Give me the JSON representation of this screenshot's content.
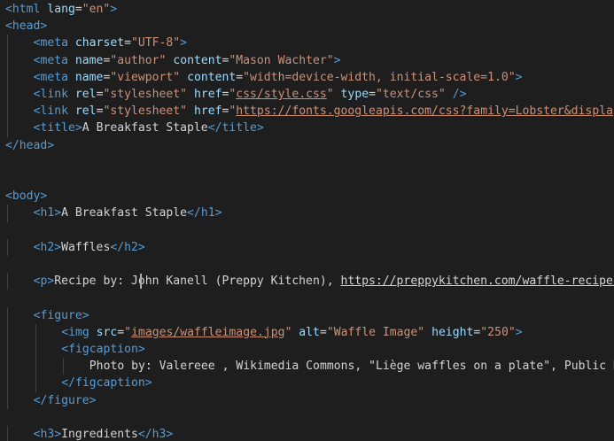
{
  "editor": {
    "language": "html",
    "colors": {
      "background": "#1e1e1e",
      "tag": "#569cd6",
      "attribute": "#9cdcfe",
      "string": "#ce9178",
      "text": "#d4d4d4"
    },
    "lines": [
      {
        "indent": 0,
        "tokens": [
          [
            "tag",
            "<html"
          ],
          [
            "txt",
            " "
          ],
          [
            "attr",
            "lang"
          ],
          [
            "txt",
            "="
          ],
          [
            "str",
            "\"en\""
          ],
          [
            "tag",
            ">"
          ]
        ]
      },
      {
        "indent": 0,
        "tokens": [
          [
            "tag",
            "<head"
          ],
          [
            "tag",
            ">"
          ]
        ]
      },
      {
        "indent": 1,
        "tokens": [
          [
            "tag",
            "<meta"
          ],
          [
            "txt",
            " "
          ],
          [
            "attr",
            "charset"
          ],
          [
            "txt",
            "="
          ],
          [
            "str",
            "\"UTF-8\""
          ],
          [
            "tag",
            ">"
          ]
        ]
      },
      {
        "indent": 1,
        "tokens": [
          [
            "tag",
            "<meta"
          ],
          [
            "txt",
            " "
          ],
          [
            "attr",
            "name"
          ],
          [
            "txt",
            "="
          ],
          [
            "str",
            "\"author\""
          ],
          [
            "txt",
            " "
          ],
          [
            "attr",
            "content"
          ],
          [
            "txt",
            "="
          ],
          [
            "str",
            "\"Mason Wachter\""
          ],
          [
            "tag",
            ">"
          ]
        ]
      },
      {
        "indent": 1,
        "tokens": [
          [
            "tag",
            "<meta"
          ],
          [
            "txt",
            " "
          ],
          [
            "attr",
            "name"
          ],
          [
            "txt",
            "="
          ],
          [
            "str",
            "\"viewport\""
          ],
          [
            "txt",
            " "
          ],
          [
            "attr",
            "content"
          ],
          [
            "txt",
            "="
          ],
          [
            "str",
            "\"width=device-width, initial-scale=1.0\""
          ],
          [
            "tag",
            ">"
          ]
        ]
      },
      {
        "indent": 1,
        "tokens": [
          [
            "tag",
            "<link"
          ],
          [
            "txt",
            " "
          ],
          [
            "attr",
            "rel"
          ],
          [
            "txt",
            "="
          ],
          [
            "str",
            "\"stylesheet\""
          ],
          [
            "txt",
            " "
          ],
          [
            "attr",
            "href"
          ],
          [
            "txt",
            "="
          ],
          [
            "str",
            "\""
          ],
          [
            "str-link",
            "css/style.css"
          ],
          [
            "str",
            "\""
          ],
          [
            "txt",
            " "
          ],
          [
            "attr",
            "type"
          ],
          [
            "txt",
            "="
          ],
          [
            "str",
            "\"text/css\""
          ],
          [
            "txt",
            " "
          ],
          [
            "tag",
            "/>"
          ]
        ]
      },
      {
        "indent": 1,
        "tokens": [
          [
            "tag",
            "<link"
          ],
          [
            "txt",
            " "
          ],
          [
            "attr",
            "rel"
          ],
          [
            "txt",
            "="
          ],
          [
            "str",
            "\"stylesheet\""
          ],
          [
            "txt",
            " "
          ],
          [
            "attr",
            "href"
          ],
          [
            "txt",
            "="
          ],
          [
            "str",
            "\""
          ],
          [
            "str-link",
            "https://fonts.googleapis.com/css?family=Lobster&display=swap"
          ],
          [
            "str",
            "\""
          ],
          [
            "txt",
            " "
          ],
          [
            "tag",
            "/>"
          ]
        ]
      },
      {
        "indent": 1,
        "tokens": [
          [
            "tag",
            "<title"
          ],
          [
            "tag",
            ">"
          ],
          [
            "txt",
            "A Breakfast Staple"
          ],
          [
            "tag",
            "</title>"
          ]
        ]
      },
      {
        "indent": 0,
        "tokens": [
          [
            "tag",
            "</head>"
          ]
        ]
      },
      {
        "indent": 0,
        "tokens": []
      },
      {
        "indent": 0,
        "tokens": []
      },
      {
        "indent": 0,
        "tokens": [
          [
            "tag",
            "<body"
          ],
          [
            "tag",
            ">"
          ]
        ]
      },
      {
        "indent": 1,
        "tokens": [
          [
            "tag",
            "<h1"
          ],
          [
            "tag",
            ">"
          ],
          [
            "txt",
            "A Breakfast Staple"
          ],
          [
            "tag",
            "</h1>"
          ]
        ]
      },
      {
        "indent": 0,
        "tokens": []
      },
      {
        "indent": 1,
        "tokens": [
          [
            "tag",
            "<h2"
          ],
          [
            "tag",
            ">"
          ],
          [
            "txt",
            "Waffles"
          ],
          [
            "tag",
            "</h2>"
          ]
        ]
      },
      {
        "indent": 0,
        "tokens": []
      },
      {
        "indent": 1,
        "tokens": [
          [
            "tag",
            "<p"
          ],
          [
            "tag",
            ">"
          ],
          [
            "txt",
            "Recipe by: John Kanell (Preppy Kitchen), "
          ],
          [
            "txt-link",
            "https://preppykitchen.com/waffle-recipe/"
          ],
          [
            "tag",
            "</p>"
          ]
        ]
      },
      {
        "indent": 0,
        "tokens": []
      },
      {
        "indent": 1,
        "tokens": [
          [
            "tag",
            "<figure"
          ],
          [
            "tag",
            ">"
          ]
        ]
      },
      {
        "indent": 2,
        "tokens": [
          [
            "tag",
            "<img"
          ],
          [
            "txt",
            " "
          ],
          [
            "attr",
            "src"
          ],
          [
            "txt",
            "="
          ],
          [
            "str",
            "\""
          ],
          [
            "str-link",
            "images/waffleimage.jpg"
          ],
          [
            "str",
            "\""
          ],
          [
            "txt",
            " "
          ],
          [
            "attr",
            "alt"
          ],
          [
            "txt",
            "="
          ],
          [
            "str",
            "\"Waffle Image\""
          ],
          [
            "txt",
            " "
          ],
          [
            "attr",
            "height"
          ],
          [
            "txt",
            "="
          ],
          [
            "str",
            "\"250\""
          ],
          [
            "tag",
            ">"
          ]
        ]
      },
      {
        "indent": 2,
        "tokens": [
          [
            "tag",
            "<figcaption"
          ],
          [
            "tag",
            ">"
          ]
        ]
      },
      {
        "indent": 3,
        "tokens": [
          [
            "txt",
            "Photo by: Valereee , Wikimedia Commons, \"Liège waffles on a plate\", Public Domain"
          ]
        ]
      },
      {
        "indent": 2,
        "tokens": [
          [
            "tag",
            "</figcaption>"
          ]
        ]
      },
      {
        "indent": 1,
        "tokens": [
          [
            "tag",
            "</figure>"
          ]
        ]
      },
      {
        "indent": 0,
        "tokens": []
      },
      {
        "indent": 1,
        "tokens": [
          [
            "tag",
            "<h3"
          ],
          [
            "tag",
            ">"
          ],
          [
            "txt",
            "Ingredients"
          ],
          [
            "tag",
            "</h3>"
          ]
        ]
      }
    ]
  }
}
